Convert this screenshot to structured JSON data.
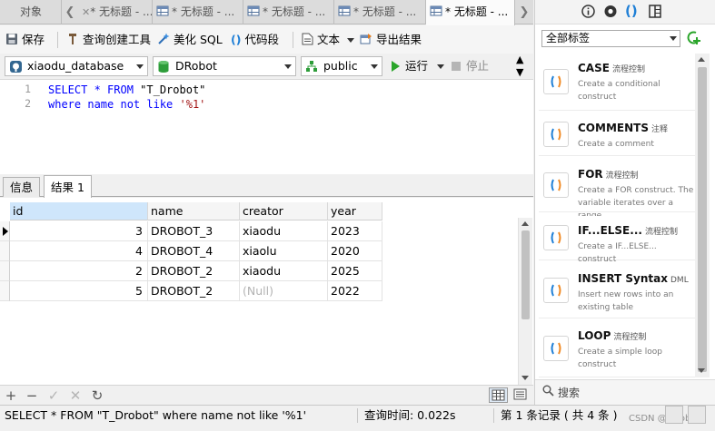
{
  "tabs": {
    "objects_label": "对象",
    "items": [
      {
        "label": "* 无标题 - ..."
      },
      {
        "label": "* 无标题 - ..."
      },
      {
        "label": "* 无标题 - ..."
      },
      {
        "label": "* 无标题 - ..."
      },
      {
        "label": "* 无标题 - ..."
      }
    ],
    "more_glyph": "❯",
    "back_glyph": "❮"
  },
  "toolbar": {
    "save": "保存",
    "query_builder": "查询创建工具",
    "beautify": "美化 SQL",
    "snippet": "代码段",
    "text": "文本",
    "export": "导出结果"
  },
  "connection": {
    "connection_name": "xiaodu_database",
    "database": "DRobot",
    "schema": "public",
    "run": "运行",
    "stop": "停止"
  },
  "editor": {
    "lines": [
      {
        "num": "1",
        "parts": [
          {
            "t": "SELECT * FROM ",
            "c": "kw"
          },
          {
            "t": "\"T_Drobot\"",
            "c": "plain"
          }
        ]
      },
      {
        "num": "2",
        "parts": [
          {
            "t": "where name not like ",
            "c": "kw"
          },
          {
            "t": "'%1'",
            "c": "str"
          }
        ]
      }
    ]
  },
  "result_tabs": {
    "info": "信息",
    "result1": "结果 1"
  },
  "grid": {
    "columns": [
      "id",
      "name",
      "creator",
      "year"
    ],
    "rows": [
      {
        "id": "3",
        "name": "DROBOT_3",
        "creator": "xiaodu",
        "year": "2023",
        "current": true
      },
      {
        "id": "4",
        "name": "DROBOT_4",
        "creator": "xiaolu",
        "year": "2020",
        "current": false
      },
      {
        "id": "2",
        "name": "DROBOT_2",
        "creator": "xiaodu",
        "year": "2025",
        "current": false
      },
      {
        "id": "5",
        "name": "DROBOT_2",
        "creator": "(Null)",
        "year": "2022",
        "current": false
      }
    ]
  },
  "bottombar": {
    "add": "+",
    "delete": "−",
    "apply": "✓",
    "discard": "✕",
    "refresh": "↻"
  },
  "status": {
    "sql": "SELECT * FROM \"T_Drobot\" where name not like '%1'",
    "query_time": "查询时间: 0.022s",
    "record": "第 1 条记录 ( 共 4 条 )",
    "watermark": "CSDN @DRobot"
  },
  "right_panel": {
    "category": "全部标签",
    "snippets": [
      {
        "title": "CASE",
        "tag": "流程控制",
        "desc": "Create a conditional construct"
      },
      {
        "title": "COMMENTS",
        "tag": "注释",
        "desc": "Create a comment"
      },
      {
        "title": "FOR",
        "tag": "流程控制",
        "desc": "Create a FOR construct. The variable iterates over a range."
      },
      {
        "title": "IF...ELSE...",
        "tag": "流程控制",
        "desc": "Create a IF...ELSE... construct"
      },
      {
        "title": "INSERT Syntax",
        "tag": "DML",
        "desc": "Insert new rows into an existing table"
      },
      {
        "title": "LOOP",
        "tag": "流程控制",
        "desc": "Create a simple loop construct"
      }
    ],
    "search_label": "搜索"
  },
  "colors": {
    "keyword": "#0000ff",
    "string": "#a31515",
    "run_green": "#2aa52a",
    "snippet_blue": "#1f7fd6",
    "snippet_orange": "#f08a24"
  }
}
